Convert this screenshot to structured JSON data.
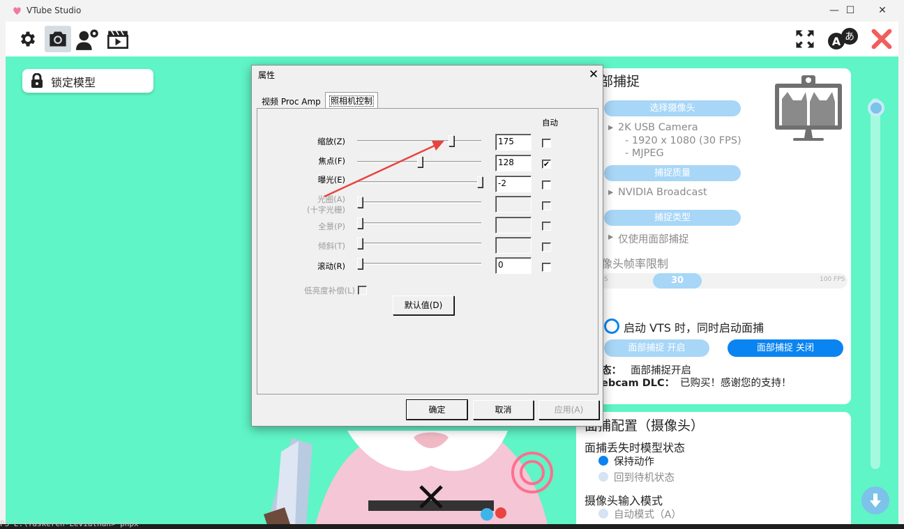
{
  "window": {
    "title": "VTube Studio",
    "minimize": "—",
    "maximize": "☐",
    "close": "✕"
  },
  "toolbar": {
    "left_icons": [
      "gear-icon",
      "camera-icon",
      "user-settings-icon",
      "clapperboard-icon"
    ],
    "right_icons": [
      "fullscreen-icon",
      "language-icon",
      "close-x-icon"
    ],
    "close_color": "#f25c5c"
  },
  "lock_button": {
    "label": "锁定模型"
  },
  "panel": {
    "title": "部捕捉",
    "select_camera": "选择摄像头",
    "camera_name": "2K USB Camera",
    "camera_res": "- 1920 x 1080 (30 FPS)",
    "camera_format": "- MJPEG",
    "capture_quality": "捕捉质量",
    "quality_value": "NVIDIA Broadcast",
    "capture_type": "捕捉类型",
    "type_value": "仅使用面部捕捉",
    "fps_limit_title": "像头帧率限制",
    "fps_min": "S",
    "fps_value": "30",
    "fps_max": "100 FPS",
    "autostart_label": "启动 VTS 时，同时启动面捕",
    "tracking_on": "面部捕捉 开启",
    "tracking_off": "面部捕捉 关闭",
    "status_label": "态：",
    "status_value": "面部捕捉开启",
    "dlc_label": "ebcam DLC：",
    "dlc_value": "已购买！感谢您的支持！",
    "accent": "#0a84f0",
    "pill_color": "#a7d6f7"
  },
  "panel2": {
    "title": "面捕配置（摄像头）",
    "lost_title": "面捕丢失时模型状态",
    "opt_keep": "保持动作",
    "opt_idle": "回到待机状态",
    "input_title": "摄像头输入模式",
    "opt_auto": "自动模式（A）"
  },
  "dialog": {
    "title": "属性",
    "close": "✕",
    "tab1": "视频 Proc Amp",
    "tab2": "照相机控制",
    "auto_header": "自动",
    "rows": [
      {
        "label": "缩放(Z)",
        "value": "175",
        "slider": 0.76,
        "auto": false,
        "enabled": true
      },
      {
        "label": "焦点(F)",
        "value": "128",
        "slider": 0.5,
        "auto": true,
        "enabled": true
      },
      {
        "label": "曝光(E)",
        "value": "-2",
        "slider": 1.0,
        "auto": false,
        "enabled": true
      },
      {
        "label": "光圈(A)",
        "sublabel": "(十字光栅)",
        "value": "",
        "slider": 0.0,
        "auto": false,
        "enabled": false
      },
      {
        "label": "全景(P)",
        "value": "",
        "slider": 0.0,
        "auto": false,
        "enabled": false
      },
      {
        "label": "倾斜(T)",
        "value": "",
        "slider": 0.0,
        "auto": false,
        "enabled": false
      },
      {
        "label": "滚动(R)",
        "value": "0",
        "slider": 0.0,
        "auto": false,
        "enabled": true
      }
    ],
    "low_light": "低亮度补偿(L)",
    "default_btn": "默认值(D)",
    "ok": "确定",
    "cancel": "取消",
    "apply": "应用(A)"
  },
  "terminal": {
    "line": "PS E:\\Yaskeren-Leviathan> pnpx"
  }
}
